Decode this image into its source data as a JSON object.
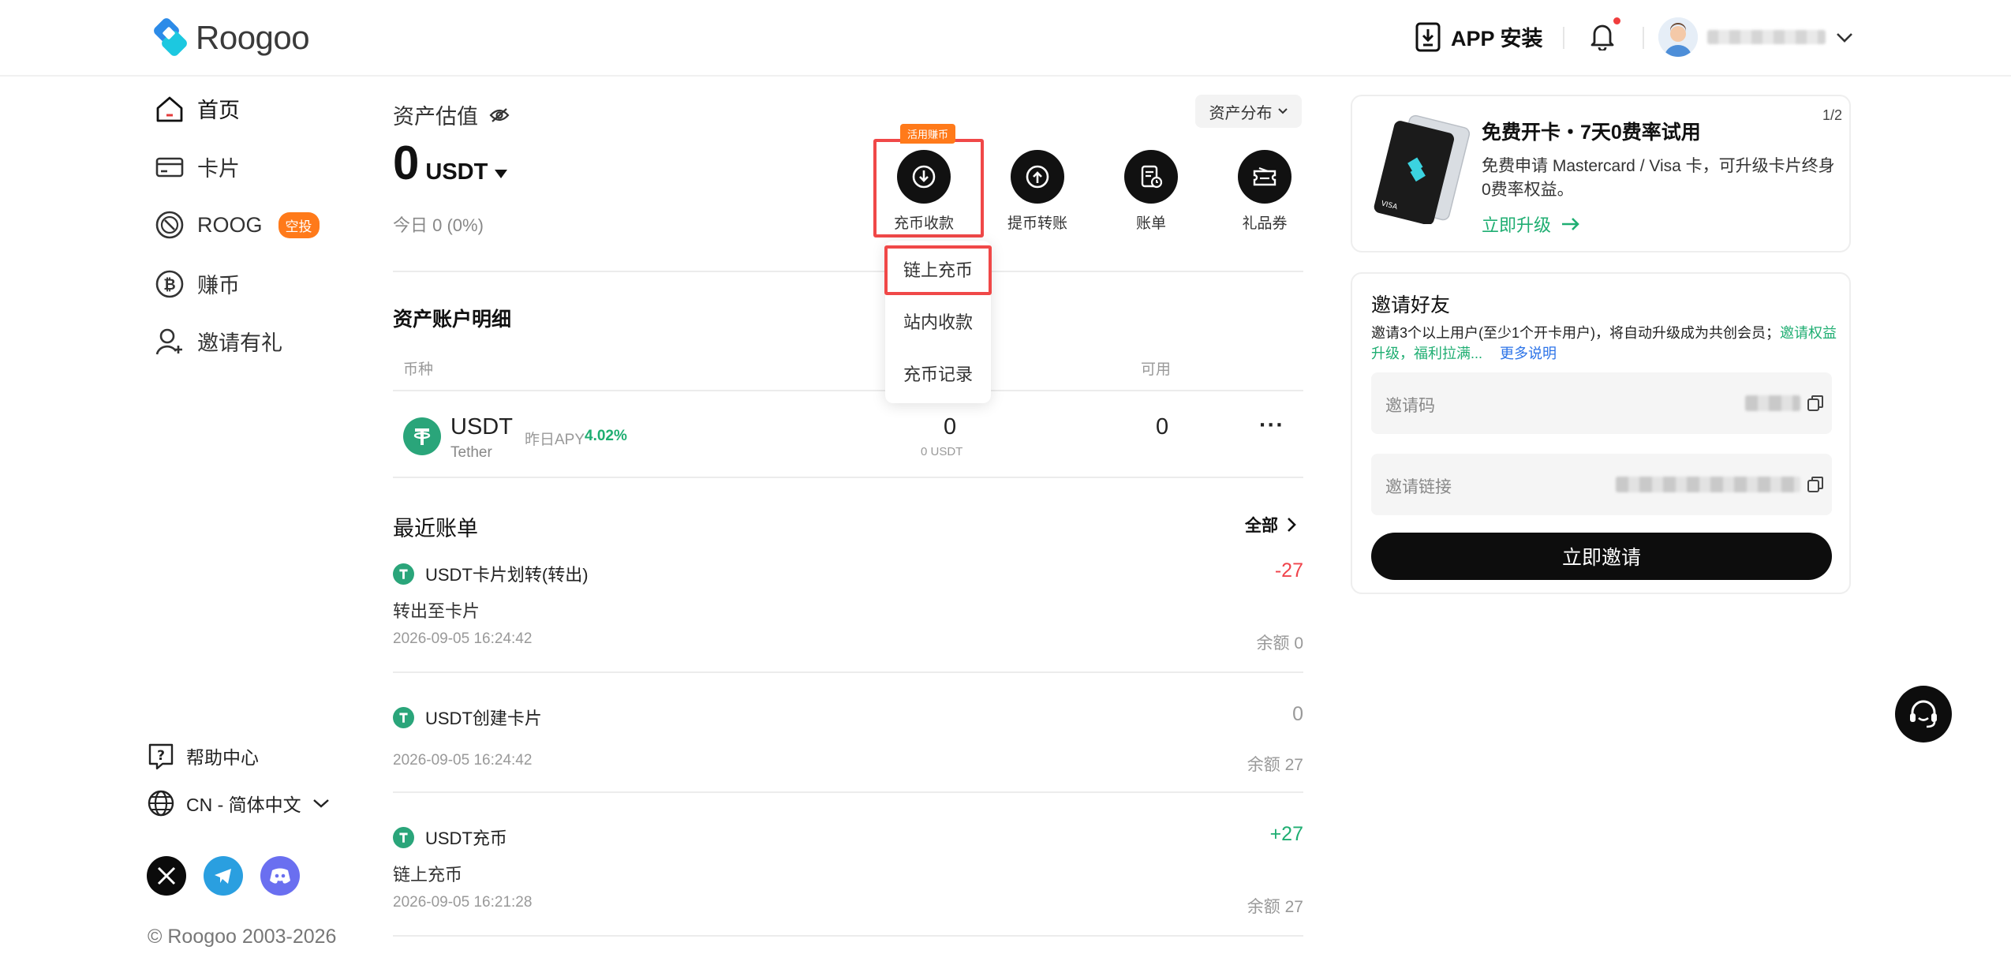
{
  "header": {
    "logo_text": "Roogoo",
    "app_install": "APP 安装"
  },
  "sidebar": {
    "items": [
      {
        "label": "首页"
      },
      {
        "label": "卡片"
      },
      {
        "label": "ROOG",
        "badge": "空投"
      },
      {
        "label": "赚币"
      },
      {
        "label": "邀请有礼"
      }
    ],
    "help": "帮助中心",
    "language": "CN - 简体中文",
    "copyright": "© Roogoo 2003-2026"
  },
  "assets": {
    "title": "资产估值",
    "value": "0",
    "unit": "USDT",
    "today": "今日 0 (0%)",
    "distribution_btn": "资产分布"
  },
  "actions": [
    {
      "label": "充币收款",
      "tag": "活用赚币"
    },
    {
      "label": "提币转账"
    },
    {
      "label": "账单"
    },
    {
      "label": "礼品券"
    }
  ],
  "deposit_menu": [
    "链上充币",
    "站内收款",
    "充币记录"
  ],
  "account_detail": {
    "title": "资产账户明细",
    "col_currency": "币种",
    "col_available": "可用",
    "rows": [
      {
        "symbol": "USDT",
        "name": "Tether",
        "apy_label": "昨日APY",
        "apy": "4.02%",
        "total": "0",
        "total_sub": "0 USDT",
        "available": "0",
        "more": "···"
      }
    ]
  },
  "recent": {
    "title": "最近账单",
    "all": "全部",
    "items": [
      {
        "title": "USDT卡片划转(转出)",
        "sub": "转出至卡片",
        "time": "2026-09-05 16:24:42",
        "amount": "-27",
        "balance": "余额 0"
      },
      {
        "title": "USDT创建卡片",
        "sub": "",
        "time": "2026-09-05 16:24:42",
        "amount": "0",
        "balance": "余额 27"
      },
      {
        "title": "USDT充币",
        "sub": "链上充币",
        "time": "2026-09-05 16:21:28",
        "amount": "+27",
        "balance": "余额 27"
      }
    ]
  },
  "promo": {
    "title": "免费开卡・7天0费率试用",
    "desc": "免费申请 Mastercard / Visa 卡，可升级卡片终身0费率权益。",
    "cta": "立即升级",
    "pager": "1/2"
  },
  "invite": {
    "title": "邀请好友",
    "desc_prefix": "邀请3个以上用户(至少1个开卡用户)，将自动升级成为共创会员；",
    "desc_link": "邀请权益升级，福利拉满...",
    "more": "更多说明",
    "code_label": "邀请码",
    "link_label": "邀请链接",
    "button": "立即邀请"
  },
  "colors": {
    "accent_green": "#1fae72",
    "danger_red": "#f0444c",
    "badge_orange": "#ff7a1a",
    "highlight_red": "#f04848",
    "primary_black": "#0d0d0d"
  }
}
